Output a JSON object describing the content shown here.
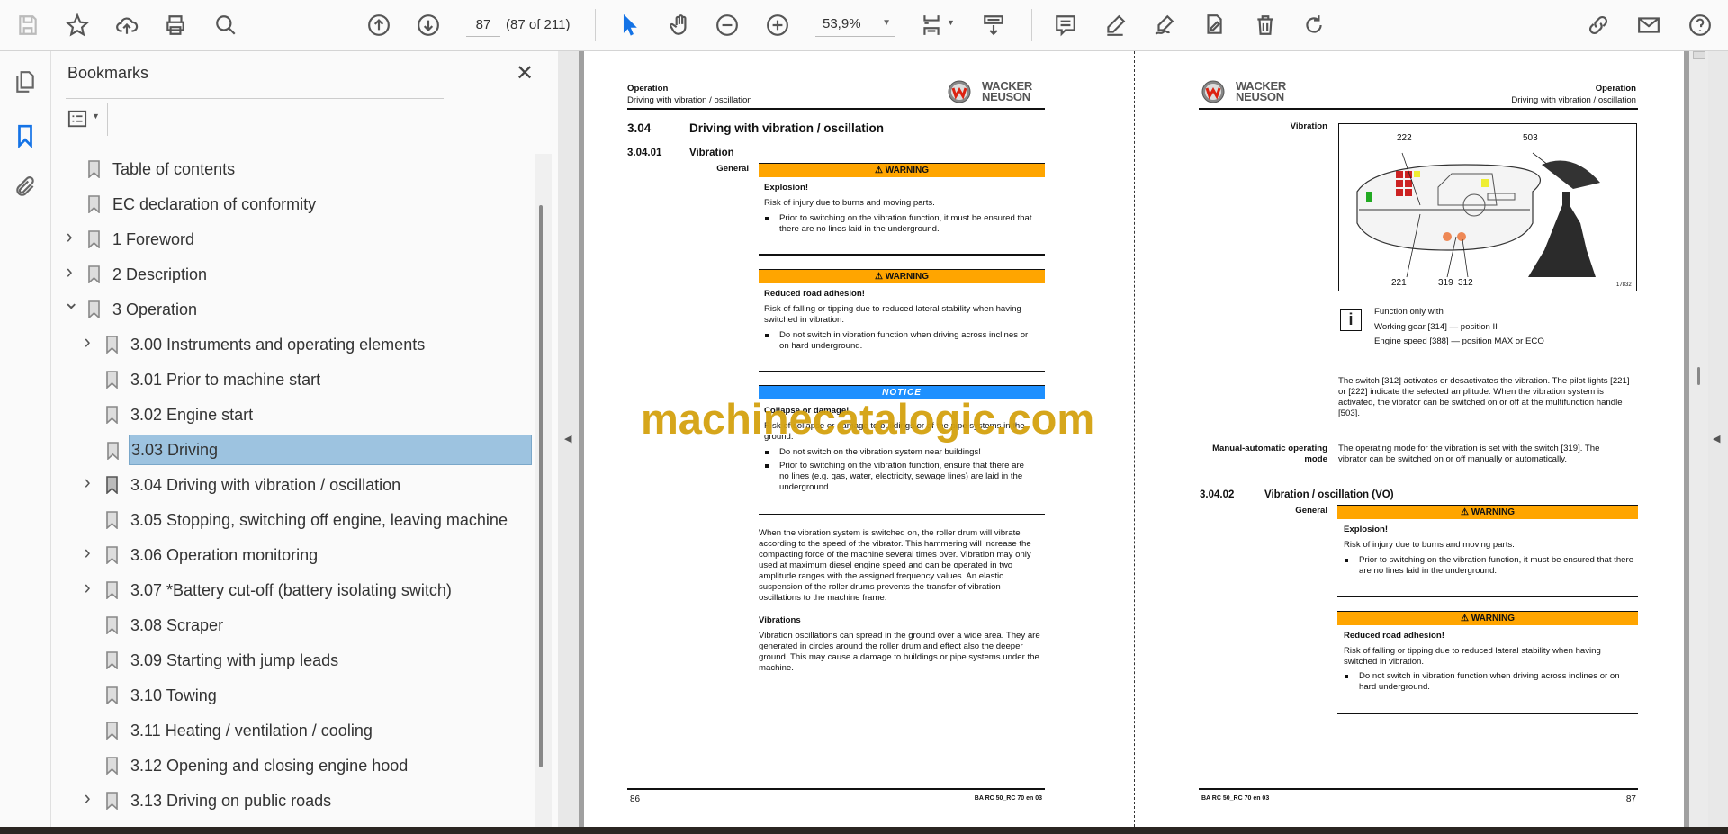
{
  "toolbar": {
    "page_number": "87",
    "page_count": "(87 of 211)",
    "zoom": "53,9%",
    "icons": [
      "save-icon",
      "star-icon",
      "upload-icon",
      "print-icon",
      "find-icon",
      "page-up-icon",
      "page-down-icon",
      "select-cursor-icon",
      "hand-icon",
      "zoom-out-icon",
      "zoom-in-icon",
      "fit-page-icon",
      "scroll-mode-icon",
      "comment-icon",
      "highlight-pen-icon",
      "sign-icon",
      "fill-sign-icon",
      "delete-icon",
      "rotate-icon",
      "share-link-icon",
      "mail-icon",
      "help-icon"
    ]
  },
  "panel": {
    "title": "Bookmarks",
    "items": [
      {
        "label": "Table of contents",
        "level": 0,
        "chevron": ""
      },
      {
        "label": "EC declaration of conformity",
        "level": 0,
        "chevron": ""
      },
      {
        "label": "1 Foreword",
        "level": 0,
        "chevron": "right"
      },
      {
        "label": "2 Description",
        "level": 0,
        "chevron": "right"
      },
      {
        "label": "3 Operation",
        "level": 0,
        "chevron": "down"
      },
      {
        "label": "3.00 Instruments and operating elements",
        "level": 1,
        "chevron": "right"
      },
      {
        "label": "3.01 Prior to machine start",
        "level": 1,
        "chevron": ""
      },
      {
        "label": "3.02 Engine start",
        "level": 1,
        "chevron": ""
      },
      {
        "label": "3.03 Driving",
        "level": 1,
        "chevron": "",
        "selected": true
      },
      {
        "label": "3.04 Driving with vibration / oscillation",
        "level": 1,
        "chevron": "right"
      },
      {
        "label": "3.05 Stopping, switching off engine, leaving machine",
        "level": 1,
        "chevron": ""
      },
      {
        "label": "3.06 Operation monitoring",
        "level": 1,
        "chevron": "right"
      },
      {
        "label": "3.07 *Battery cut-off (battery isolating switch)",
        "level": 1,
        "chevron": "right"
      },
      {
        "label": "3.08 Scraper",
        "level": 1,
        "chevron": ""
      },
      {
        "label": "3.09 Starting with jump leads",
        "level": 1,
        "chevron": ""
      },
      {
        "label": "3.10 Towing",
        "level": 1,
        "chevron": ""
      },
      {
        "label": "3.11 Heating / ventilation / cooling",
        "level": 1,
        "chevron": ""
      },
      {
        "label": "3.12 Opening and closing engine hood",
        "level": 1,
        "chevron": ""
      },
      {
        "label": "3.13 Driving on public roads",
        "level": 1,
        "chevron": "right"
      }
    ]
  },
  "logo": {
    "line1": "WACKER",
    "line2": "NEUSON"
  },
  "left_page": {
    "header_section": "Operation",
    "header_sub": "Driving with vibration / oscillation",
    "h1_num": "3.04",
    "h1_title": "Driving with vibration / oscillation",
    "h2_num": "3.04.01",
    "h2_title": "Vibration",
    "general": "General",
    "warn1": {
      "label": "WARNING",
      "title": "Explosion!",
      "text": "Risk of injury due to burns and moving parts.",
      "bullet": "Prior to switching on the vibration function, it must be ensured that there are no lines laid in the underground."
    },
    "warn2": {
      "label": "WARNING",
      "title": "Reduced road adhesion!",
      "text": "Risk of falling or tipping due to reduced lateral stability when having switched in vibration.",
      "bullet": "Do not switch in vibration function when driving across inclines or on hard underground."
    },
    "notice": {
      "label": "NOTICE",
      "title": "Collapse or damage!",
      "text": "Risk of collapse or damage to buildings or of the pipe systems in the ground.",
      "bullet1": "Do not switch on the vibration system near buildings!",
      "bullet2": "Prior to switching on the vibration function, ensure that there are no lines (e.g. gas, water, electricity, sewage lines) are laid in the underground."
    },
    "para": "When the vibration system is switched on, the roller drum will vibrate according to the speed of the vibrator. This hammering will increase the compacting force of the machine several times over. Vibration may only used at maximum diesel engine speed and can be operated in two amplitude ranges with the assigned frequency values. An elastic suspension of the roller drums prevents the transfer of vibration oscillations to the machine frame.",
    "vib_title": "Vibrations",
    "vib_para": "Vibration oscillations can spread in the ground over a wide area. They are generated in circles around the roller drum and effect also the deeper ground. This may cause a damage to buildings or pipe systems under the machine.",
    "page_no": "86",
    "doc_code": "BA RC 50_RC 70 en 03"
  },
  "right_page": {
    "header_section": "Operation",
    "header_sub": "Driving with vibration / oscillation",
    "vibration_label": "Vibration",
    "figure": {
      "c222": "222",
      "c503": "503",
      "c221": "221",
      "c319": "319",
      "c312": "312",
      "fig_id": "17832"
    },
    "info_l1": "Function only with",
    "info_l2": "Working gear [314] — position II",
    "info_l3": "Engine speed [388] — position MAX or ECO",
    "para1": "The switch [312] activates or desactivates the vibration. The pilot lights [221] or [222] indicate the selected amplitude. When the vibration system is activated, the vibrator can be switched on or off at the multifunction handle [503].",
    "manual_label": "Manual-automatic operating mode",
    "manual_text": "The operating mode for the vibration is set with the switch [319]. The vibrator can be switched on or off manually or automatically.",
    "h2_num": "3.04.02",
    "h2_title": "Vibration / oscillation (VO)",
    "general": "General",
    "warn1": {
      "label": "WARNING",
      "title": "Explosion!",
      "text": "Risk of injury due to burns and moving parts.",
      "bullet": "Prior to switching on the vibration function, it must be ensured that there are no lines laid in the underground."
    },
    "warn2": {
      "label": "WARNING",
      "title": "Reduced road adhesion!",
      "text": "Risk of falling or tipping due to reduced lateral stability when having switched in vibration.",
      "bullet": "Do not switch in vibration function when driving across inclines or on hard underground."
    },
    "doc_code": "BA RC 50_RC 70 en 03",
    "page_no": "87"
  },
  "watermark": "machinecatalogic.com",
  "colors": {
    "warning": "#ffa500",
    "notice": "#1e90ff",
    "selection": "#9dc3e0",
    "accent": "#1473e6",
    "watermark": "#d4a20f"
  }
}
